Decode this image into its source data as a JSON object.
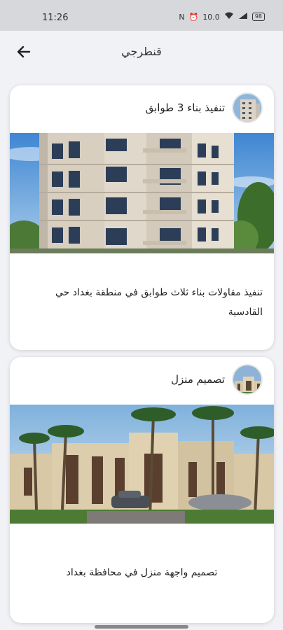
{
  "status": {
    "time": "11:26",
    "net": "10.0",
    "battery": "98"
  },
  "header": {
    "title": "قنطرجي"
  },
  "cards": [
    {
      "title": "تنفيذ بناء 3 طوابق",
      "description": "تنفيذ مقاولات بناء ثلاث طوابق في منطقة بغداد حي القادسية",
      "avatar_icon": "building-photo",
      "image_icon": "apartment-building-photo"
    },
    {
      "title": "تصميم منزل",
      "description": "تصميم واجهة منزل في محافظة بغداد",
      "avatar_icon": "house-photo",
      "image_icon": "house-facade-photo"
    }
  ],
  "colors": {
    "background": "#f1f2f6",
    "statusbar": "#d7d8dc",
    "card": "#ffffff",
    "sky": "#4a8fd6"
  }
}
